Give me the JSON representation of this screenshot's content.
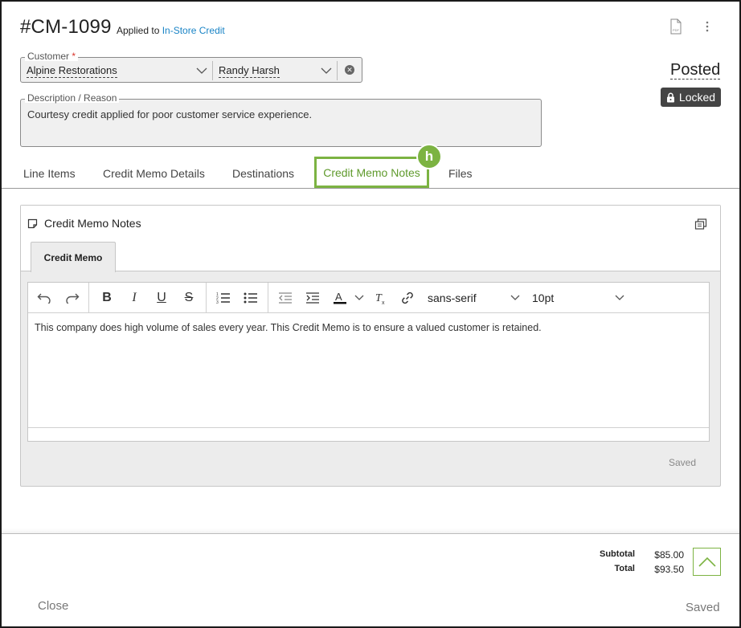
{
  "header": {
    "number": "#CM-1099",
    "applied_prefix": "Applied to",
    "applied_link": "In-Store Credit"
  },
  "customer": {
    "label": "Customer",
    "required_mark": "*",
    "name": "Alpine Restorations",
    "contact": "Randy Harsh"
  },
  "status": {
    "text": "Posted",
    "lock_badge": "Locked"
  },
  "description": {
    "label": "Description / Reason",
    "value": "Courtesy credit applied for poor customer service experience."
  },
  "tabs": [
    {
      "label": "Line Items"
    },
    {
      "label": "Credit Memo Details"
    },
    {
      "label": "Destinations"
    },
    {
      "label": "Credit Memo Notes",
      "hotkey": "h"
    },
    {
      "label": "Files"
    }
  ],
  "notes_panel": {
    "title": "Credit Memo Notes",
    "subtab": "Credit Memo",
    "font": "sans-serif",
    "size": "10pt",
    "content": "This company does high volume of sales every year. This Credit Memo is to ensure a valued customer is retained.",
    "saved": "Saved"
  },
  "totals": {
    "subtotal_label": "Subtotal",
    "subtotal_value": "$85.00",
    "total_label": "Total",
    "total_value": "$93.50"
  },
  "footer": {
    "close": "Close",
    "saved": "Saved"
  },
  "colors": {
    "accent_green": "#7cb342",
    "link_blue": "#1a84c6",
    "badge_dark": "#444444"
  }
}
